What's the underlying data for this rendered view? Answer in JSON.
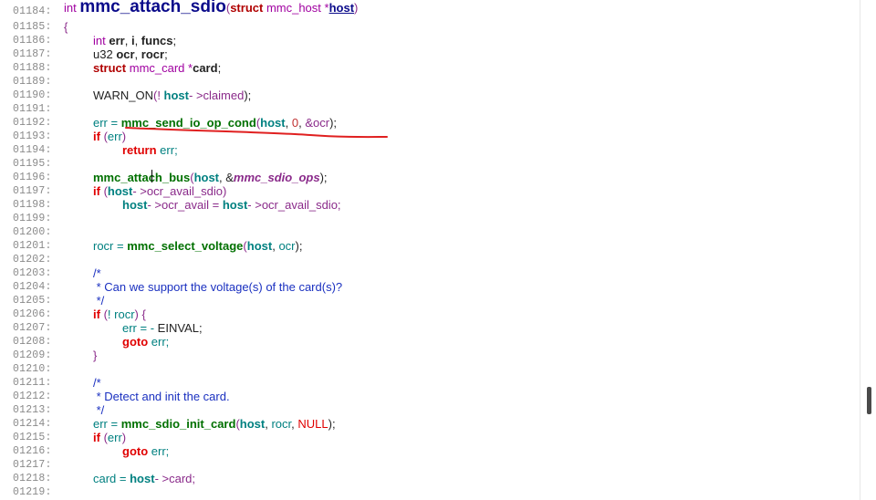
{
  "code_lines": [
    {
      "num": "01184:",
      "indent": 0,
      "tokens": [
        [
          "int ",
          "t-type"
        ],
        [
          "mmc_attach_sdio",
          "big"
        ],
        [
          "(",
          "t-punct"
        ],
        [
          "struct",
          "t-kw"
        ],
        [
          " mmc_host *",
          "t-type"
        ],
        [
          "host",
          "t-host-link"
        ],
        [
          ")",
          "t-punct"
        ]
      ]
    },
    {
      "num": "01185:",
      "indent": 0,
      "tokens": [
        [
          "{",
          "t-punct"
        ]
      ]
    },
    {
      "num": "01186:",
      "indent": 1,
      "tokens": [
        [
          "int ",
          "t-type"
        ],
        [
          "err",
          "t-id"
        ],
        [
          ", ",
          "t-plain"
        ],
        [
          "i",
          "t-id"
        ],
        [
          ", ",
          "t-plain"
        ],
        [
          "funcs",
          "t-id"
        ],
        [
          ";",
          "t-plain"
        ]
      ]
    },
    {
      "num": "01187:",
      "indent": 1,
      "tokens": [
        [
          "u32 ",
          "t-plain"
        ],
        [
          "ocr",
          "t-id"
        ],
        [
          ", ",
          "t-plain"
        ],
        [
          "rocr",
          "t-id"
        ],
        [
          ";",
          "t-plain"
        ]
      ]
    },
    {
      "num": "01188:",
      "indent": 1,
      "tokens": [
        [
          "struct",
          "t-kw"
        ],
        [
          " mmc_card *",
          "t-type"
        ],
        [
          "card",
          "t-id"
        ],
        [
          ";",
          "t-plain"
        ]
      ]
    },
    {
      "num": "01189:",
      "indent": 0,
      "tokens": []
    },
    {
      "num": "01190:",
      "indent": 1,
      "tokens": [
        [
          "WARN_ON",
          "t-macro"
        ],
        [
          "(",
          "t-punct"
        ],
        [
          "!",
          "t-punct"
        ],
        [
          " host",
          "t-mem"
        ],
        [
          "- >claimed",
          "t-punct"
        ],
        [
          ");",
          "t-plain"
        ]
      ]
    },
    {
      "num": "01191:",
      "indent": 0,
      "tokens": []
    },
    {
      "num": "01192:",
      "indent": 1,
      "tokens": [
        [
          "err =",
          "t-var"
        ],
        [
          " ",
          "t-plain"
        ],
        [
          "mmc_send_io_op_cond",
          "t-fn"
        ],
        [
          "(",
          "t-punct"
        ],
        [
          "host",
          "t-mem"
        ],
        [
          ", ",
          "t-plain"
        ],
        [
          "0",
          "t-num"
        ],
        [
          ", ",
          "t-plain"
        ],
        [
          "&ocr",
          "t-punct"
        ],
        [
          ");",
          "t-plain"
        ]
      ]
    },
    {
      "num": "01193:",
      "indent": 1,
      "tokens": [
        [
          "if",
          "t-kw2"
        ],
        [
          " (",
          "t-punct"
        ],
        [
          "err",
          "t-var"
        ],
        [
          ")",
          "t-punct"
        ]
      ]
    },
    {
      "num": "01194:",
      "indent": 2,
      "tokens": [
        [
          "return",
          "t-kw2"
        ],
        [
          " err;",
          "t-var"
        ]
      ]
    },
    {
      "num": "01195:",
      "indent": 0,
      "tokens": []
    },
    {
      "num": "01196:",
      "indent": 1,
      "tokens": [
        [
          "mmc_attach_bus",
          "t-fn"
        ],
        [
          "(",
          "t-punct"
        ],
        [
          "host",
          "t-mem"
        ],
        [
          ", &",
          "t-plain"
        ],
        [
          "mmc_sdio_ops",
          "t-ital"
        ],
        [
          ");",
          "t-plain"
        ]
      ]
    },
    {
      "num": "01197:",
      "indent": 1,
      "tokens": [
        [
          "if",
          "t-kw2"
        ],
        [
          " (",
          "t-punct"
        ],
        [
          "host",
          "t-mem"
        ],
        [
          "- >ocr_avail_sdio",
          "t-punct"
        ],
        [
          ")",
          "t-punct"
        ]
      ]
    },
    {
      "num": "01198:",
      "indent": 2,
      "tokens": [
        [
          "host",
          "t-mem"
        ],
        [
          "- >ocr_avail = ",
          "t-punct"
        ],
        [
          "host",
          "t-mem"
        ],
        [
          "- >ocr_avail_sdio;",
          "t-punct"
        ]
      ]
    },
    {
      "num": "01199:",
      "indent": 0,
      "tokens": []
    },
    {
      "num": "01200:",
      "indent": 0,
      "tokens": []
    },
    {
      "num": "01201:",
      "indent": 1,
      "tokens": [
        [
          "rocr = ",
          "t-var"
        ],
        [
          "mmc_select_voltage",
          "t-fn"
        ],
        [
          "(",
          "t-punct"
        ],
        [
          "host",
          "t-mem"
        ],
        [
          ", ",
          "t-plain"
        ],
        [
          "ocr",
          "t-var"
        ],
        [
          ");",
          "t-plain"
        ]
      ]
    },
    {
      "num": "01202:",
      "indent": 0,
      "tokens": []
    },
    {
      "num": "01203:",
      "indent": 1,
      "tokens": [
        [
          "/*",
          "t-cm"
        ]
      ]
    },
    {
      "num": "01204:",
      "indent": 1,
      "tokens": [
        [
          " * Can we support the voltage(s) of the card(s)?",
          "t-cm"
        ]
      ]
    },
    {
      "num": "01205:",
      "indent": 1,
      "tokens": [
        [
          " */",
          "t-cm"
        ]
      ]
    },
    {
      "num": "01206:",
      "indent": 1,
      "tokens": [
        [
          "if",
          "t-kw2"
        ],
        [
          " (",
          "t-punct"
        ],
        [
          "! rocr",
          "t-var"
        ],
        [
          ") {",
          "t-punct"
        ]
      ]
    },
    {
      "num": "01207:",
      "indent": 2,
      "tokens": [
        [
          "err = - ",
          "t-var"
        ],
        [
          "EINVAL",
          "t-plain"
        ],
        [
          ";",
          "t-plain"
        ]
      ]
    },
    {
      "num": "01208:",
      "indent": 2,
      "tokens": [
        [
          "goto",
          "t-kw2"
        ],
        [
          " err;",
          "t-var"
        ]
      ]
    },
    {
      "num": "01209:",
      "indent": 1,
      "tokens": [
        [
          "}",
          "t-punct"
        ]
      ]
    },
    {
      "num": "01210:",
      "indent": 0,
      "tokens": []
    },
    {
      "num": "01211:",
      "indent": 1,
      "tokens": [
        [
          "/*",
          "t-cm"
        ]
      ]
    },
    {
      "num": "01212:",
      "indent": 1,
      "tokens": [
        [
          " * Detect and init the card.",
          "t-cm"
        ]
      ]
    },
    {
      "num": "01213:",
      "indent": 1,
      "tokens": [
        [
          " */",
          "t-cm"
        ]
      ]
    },
    {
      "num": "01214:",
      "indent": 1,
      "tokens": [
        [
          "err = ",
          "t-var"
        ],
        [
          "mmc_sdio_init_card",
          "t-fn"
        ],
        [
          "(",
          "t-punct"
        ],
        [
          "host",
          "t-mem"
        ],
        [
          ", ",
          "t-plain"
        ],
        [
          "rocr",
          "t-var"
        ],
        [
          ", ",
          "t-plain"
        ],
        [
          "NULL",
          "t-null"
        ],
        [
          ");",
          "t-plain"
        ]
      ]
    },
    {
      "num": "01215:",
      "indent": 1,
      "tokens": [
        [
          "if",
          "t-kw2"
        ],
        [
          " (",
          "t-punct"
        ],
        [
          "err",
          "t-var"
        ],
        [
          ")",
          "t-punct"
        ]
      ]
    },
    {
      "num": "01216:",
      "indent": 2,
      "tokens": [
        [
          "goto",
          "t-kw2"
        ],
        [
          " err;",
          "t-var"
        ]
      ]
    },
    {
      "num": "01217:",
      "indent": 0,
      "tokens": []
    },
    {
      "num": "01218:",
      "indent": 1,
      "tokens": [
        [
          "card = ",
          "t-var"
        ],
        [
          "host",
          "t-mem"
        ],
        [
          "- >card;",
          "t-punct"
        ]
      ]
    },
    {
      "num": "01219:",
      "indent": 0,
      "tokens": []
    }
  ],
  "annotation": {
    "color": "#e02020",
    "description": "red hand-drawn underline under mmc_send_io_op_cond call"
  },
  "icons": {
    "scrollbar": "vertical-scroll-thumb"
  }
}
